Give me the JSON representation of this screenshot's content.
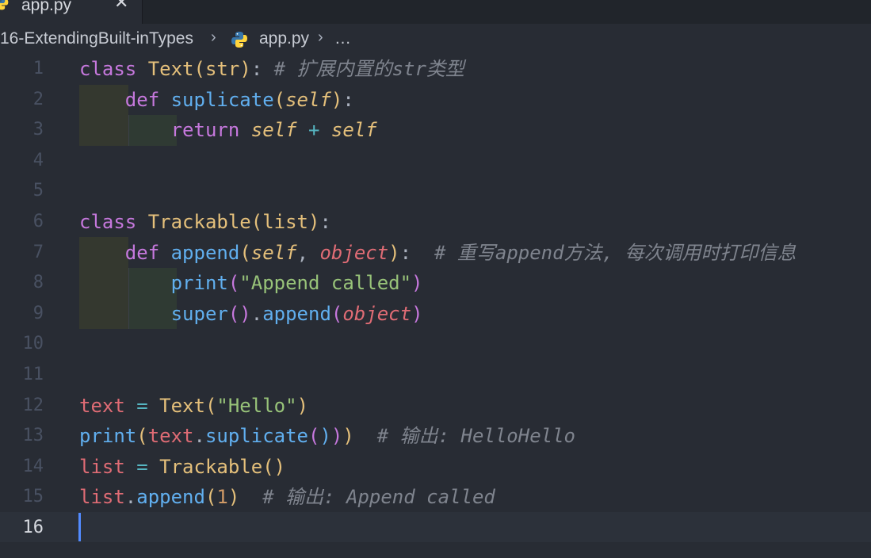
{
  "tab": {
    "filename": "app.py",
    "close_glyph": "✕",
    "icon": "python-file-icon"
  },
  "breadcrumb": {
    "folder": "16-ExtendingBuilt-inTypes",
    "file": "app.py",
    "more": "…",
    "separator": "›"
  },
  "editor": {
    "current_line": 16,
    "line_numbers": [
      "1",
      "2",
      "3",
      "4",
      "5",
      "6",
      "7",
      "8",
      "9",
      "10",
      "11",
      "12",
      "13",
      "14",
      "15",
      "16"
    ],
    "lines": [
      [
        [
          "kw",
          "class"
        ],
        [
          "pl",
          " "
        ],
        [
          "cls",
          "Text"
        ],
        [
          "p1",
          "("
        ],
        [
          "bi",
          "str"
        ],
        [
          "p1",
          ")"
        ],
        [
          "pl",
          ": "
        ],
        [
          "cm",
          "# 扩展内置的str类型"
        ]
      ],
      [
        [
          "pl",
          "    "
        ],
        [
          "kw",
          "def"
        ],
        [
          "pl",
          " "
        ],
        [
          "fn",
          "suplicate"
        ],
        [
          "p1",
          "("
        ],
        [
          "self",
          "self"
        ],
        [
          "p1",
          ")"
        ],
        [
          "pl",
          ":"
        ]
      ],
      [
        [
          "pl",
          "        "
        ],
        [
          "kw",
          "return"
        ],
        [
          "pl",
          " "
        ],
        [
          "self",
          "self"
        ],
        [
          "pl",
          " "
        ],
        [
          "op",
          "+"
        ],
        [
          "pl",
          " "
        ],
        [
          "self",
          "self"
        ]
      ],
      [],
      [],
      [
        [
          "kw",
          "class"
        ],
        [
          "pl",
          " "
        ],
        [
          "cls",
          "Trackable"
        ],
        [
          "p1",
          "("
        ],
        [
          "bi",
          "list"
        ],
        [
          "p1",
          ")"
        ],
        [
          "pl",
          ":"
        ]
      ],
      [
        [
          "pl",
          "    "
        ],
        [
          "kw",
          "def"
        ],
        [
          "pl",
          " "
        ],
        [
          "fn",
          "append"
        ],
        [
          "p1",
          "("
        ],
        [
          "self",
          "self"
        ],
        [
          "pl",
          ", "
        ],
        [
          "param",
          "object"
        ],
        [
          "p1",
          ")"
        ],
        [
          "pl",
          ":  "
        ],
        [
          "cm",
          "# 重写append方法, 每次调用时打印信息"
        ]
      ],
      [
        [
          "pl",
          "        "
        ],
        [
          "fn",
          "print"
        ],
        [
          "p2",
          "("
        ],
        [
          "str",
          "\"Append called\""
        ],
        [
          "p2",
          ")"
        ]
      ],
      [
        [
          "pl",
          "        "
        ],
        [
          "fn",
          "super"
        ],
        [
          "p2",
          "()"
        ],
        [
          "pl",
          "."
        ],
        [
          "fn",
          "append"
        ],
        [
          "p2",
          "("
        ],
        [
          "param",
          "object"
        ],
        [
          "p2",
          ")"
        ]
      ],
      [],
      [],
      [
        [
          "var",
          "text"
        ],
        [
          "pl",
          " "
        ],
        [
          "op",
          "="
        ],
        [
          "pl",
          " "
        ],
        [
          "cls",
          "Text"
        ],
        [
          "p1",
          "("
        ],
        [
          "str",
          "\"Hello\""
        ],
        [
          "p1",
          ")"
        ]
      ],
      [
        [
          "fn",
          "print"
        ],
        [
          "p1",
          "("
        ],
        [
          "var",
          "text"
        ],
        [
          "pl",
          "."
        ],
        [
          "fn",
          "suplicate"
        ],
        [
          "p2",
          "("
        ],
        [
          "p3",
          ")"
        ],
        [
          "p2",
          ")"
        ],
        [
          "p1",
          ")"
        ],
        [
          "pl",
          "  "
        ],
        [
          "cm",
          "# 输出: HelloHello"
        ]
      ],
      [
        [
          "var",
          "list"
        ],
        [
          "pl",
          " "
        ],
        [
          "op",
          "="
        ],
        [
          "pl",
          " "
        ],
        [
          "cls",
          "Trackable"
        ],
        [
          "p1",
          "()"
        ]
      ],
      [
        [
          "var",
          "list"
        ],
        [
          "pl",
          "."
        ],
        [
          "fn",
          "append"
        ],
        [
          "p1",
          "("
        ],
        [
          "num",
          "1"
        ],
        [
          "p1",
          ")"
        ],
        [
          "pl",
          "  "
        ],
        [
          "cm",
          "# 输出: Append called"
        ]
      ],
      []
    ]
  }
}
